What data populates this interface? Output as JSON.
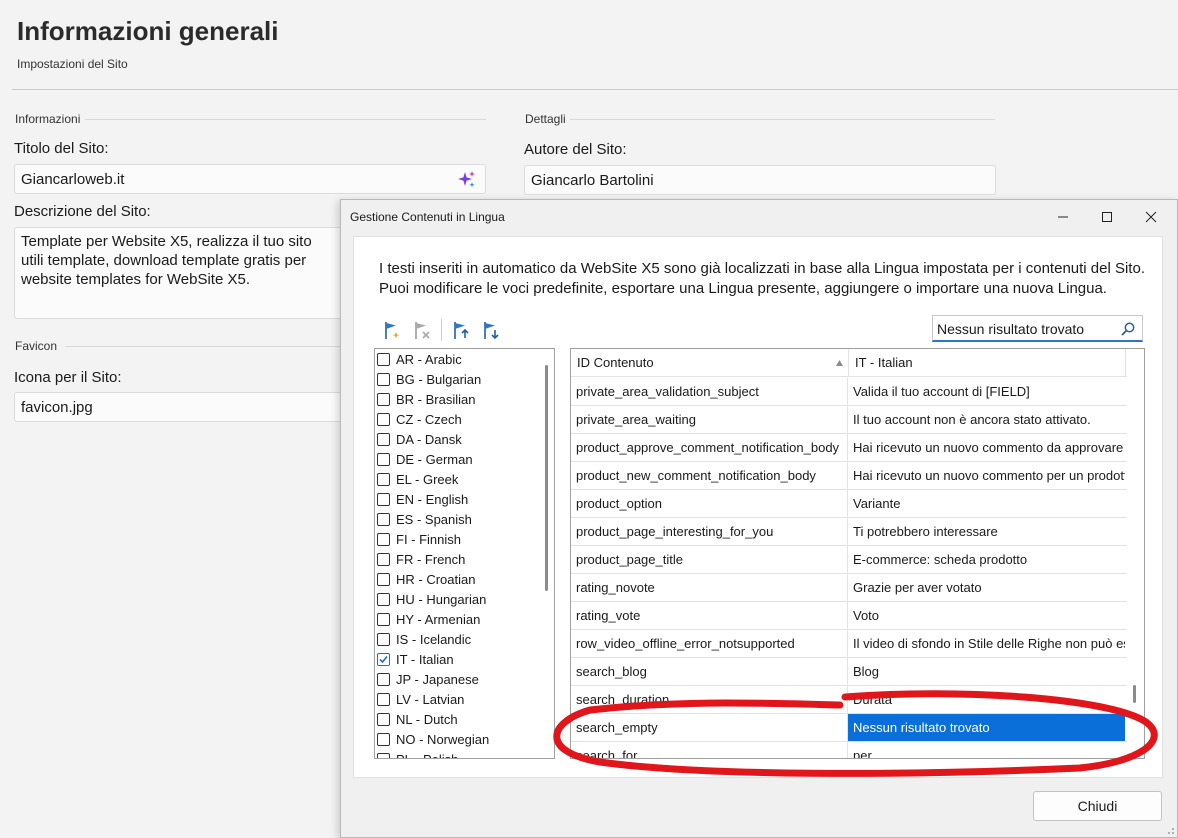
{
  "page": {
    "title": "Informazioni generali",
    "subtitle": "Impostazioni del Sito"
  },
  "info_section": {
    "heading": "Informazioni",
    "site_title_label": "Titolo del Sito:",
    "site_title_value": "Giancarloweb.it",
    "site_desc_label": "Descrizione del Sito:",
    "site_desc_value": "Template per Website X5, realizza il tuo sito utili template, download template gratis per website templates for WebSite X5."
  },
  "details_section": {
    "heading": "Dettagli",
    "author_label": "Autore del Sito:",
    "author_value": "Giancarlo Bartolini"
  },
  "favicon_section": {
    "heading": "Favicon",
    "icon_label": "Icona per il Sito:",
    "icon_value": "favicon.jpg"
  },
  "dialog": {
    "title": "Gestione Contenuti in Lingua",
    "intro": "I testi inseriti in automatico da WebSite X5 sono già localizzati in base alla Lingua impostata per i contenuti del Sito. Puoi modificare le voci predefinite, esportare una Lingua presente, aggiungere o importare una nuova Lingua.",
    "search_value": "Nessun risultato trovato",
    "close_label": "Chiudi",
    "toolbar_icons": [
      "flag-add-icon",
      "flag-remove-icon",
      "flag-export-icon",
      "flag-import-icon"
    ],
    "languages": [
      {
        "label": "AR - Arabic",
        "checked": false
      },
      {
        "label": "BG - Bulgarian",
        "checked": false
      },
      {
        "label": "BR - Brasilian",
        "checked": false
      },
      {
        "label": "CZ - Czech",
        "checked": false
      },
      {
        "label": "DA - Dansk",
        "checked": false
      },
      {
        "label": "DE - German",
        "checked": false
      },
      {
        "label": "EL - Greek",
        "checked": false
      },
      {
        "label": "EN - English",
        "checked": false
      },
      {
        "label": "ES - Spanish",
        "checked": false
      },
      {
        "label": "FI - Finnish",
        "checked": false
      },
      {
        "label": "FR - French",
        "checked": false
      },
      {
        "label": "HR - Croatian",
        "checked": false
      },
      {
        "label": "HU - Hungarian",
        "checked": false
      },
      {
        "label": "HY - Armenian",
        "checked": false
      },
      {
        "label": "IS - Icelandic",
        "checked": false
      },
      {
        "label": "IT - Italian",
        "checked": true
      },
      {
        "label": "JP - Japanese",
        "checked": false
      },
      {
        "label": "LV - Latvian",
        "checked": false
      },
      {
        "label": "NL - Dutch",
        "checked": false
      },
      {
        "label": "NO - Norwegian",
        "checked": false
      },
      {
        "label": "PL - Polish",
        "checked": false
      }
    ],
    "grid": {
      "col_id": "ID Contenuto",
      "col_lang": "IT - Italian",
      "rows": [
        {
          "id": "private_area_validation_subject",
          "value": "Valida il tuo account di [FIELD]"
        },
        {
          "id": "private_area_waiting",
          "value": "Il tuo account non è ancora stato attivato."
        },
        {
          "id": "product_approve_comment_notification_body",
          "value": "Hai ricevuto un nuovo commento da approvare"
        },
        {
          "id": "product_new_comment_notification_body",
          "value": "Hai ricevuto un nuovo commento per un prodotto"
        },
        {
          "id": "product_option",
          "value": "Variante"
        },
        {
          "id": "product_page_interesting_for_you",
          "value": "Ti potrebbero interessare"
        },
        {
          "id": "product_page_title",
          "value": "E-commerce: scheda prodotto"
        },
        {
          "id": "rating_novote",
          "value": "Grazie per aver votato"
        },
        {
          "id": "rating_vote",
          "value": "Voto"
        },
        {
          "id": "row_video_offline_error_notsupported",
          "value": "Il video di sfondo in Stile delle Righe non può essere riprodotto"
        },
        {
          "id": "search_blog",
          "value": "Blog"
        },
        {
          "id": "search_duration",
          "value": "Durata"
        },
        {
          "id": "search_empty",
          "value": "Nessun risultato trovato"
        },
        {
          "id": "search_for",
          "value": "per"
        }
      ],
      "selected_row": "search_empty"
    }
  },
  "colors": {
    "selection": "#0a6fd8",
    "annotation": "#e0161b",
    "checkbox": "#1c6fc7"
  }
}
